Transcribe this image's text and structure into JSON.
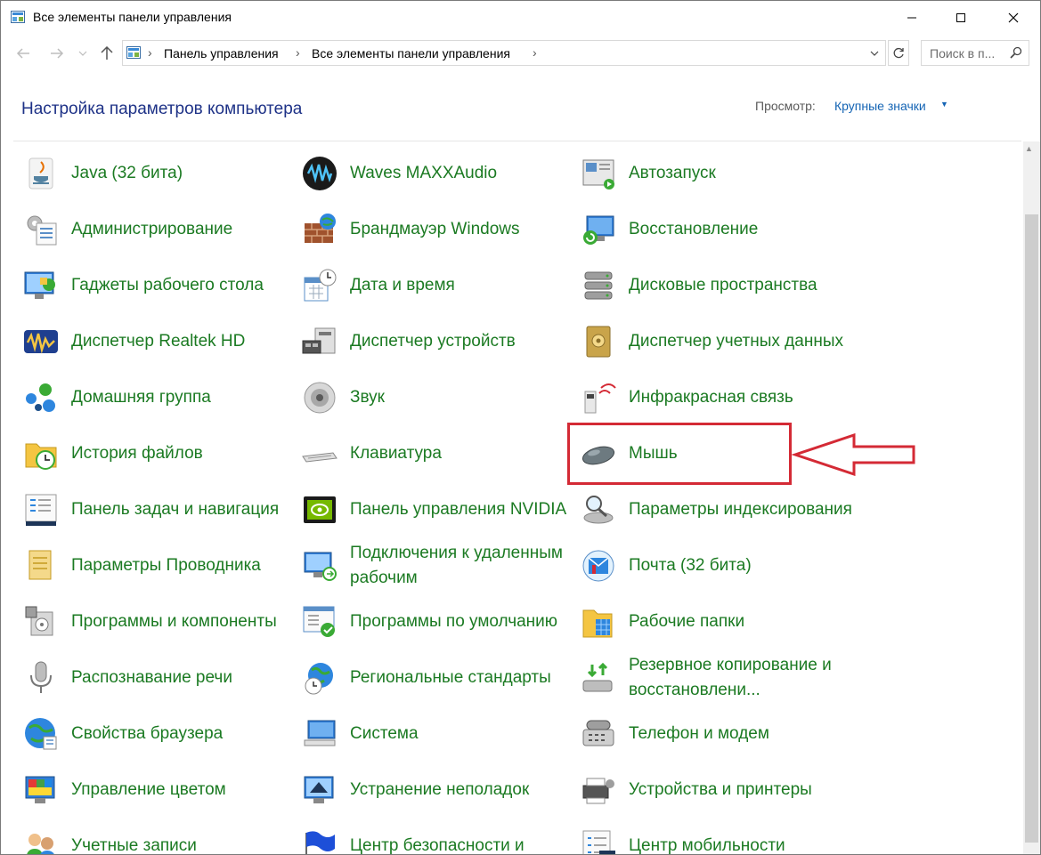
{
  "window": {
    "title": "Все элементы панели управления",
    "minimize_icon": "minimize-icon",
    "maximize_icon": "maximize-icon",
    "close_icon": "close-icon"
  },
  "address_bar": {
    "crumbs": [
      "Панель управления",
      "Все элементы панели управления"
    ],
    "search_placeholder": "Поиск в п..."
  },
  "header": {
    "title": "Настройка параметров компьютера",
    "view_label": "Просмотр:",
    "view_value": "Крупные значки"
  },
  "items": [
    {
      "label": "Java (32 бита)",
      "icon": "java-icon"
    },
    {
      "label": "Waves MAXXAudio",
      "icon": "waves-icon"
    },
    {
      "label": "Автозапуск",
      "icon": "autoplay-icon"
    },
    {
      "label": "Администрирование",
      "icon": "admin-tools-icon"
    },
    {
      "label": "Брандмауэр Windows",
      "icon": "firewall-icon"
    },
    {
      "label": "Восстановление",
      "icon": "recovery-icon"
    },
    {
      "label": "Гаджеты рабочего стола",
      "icon": "gadgets-icon"
    },
    {
      "label": "Дата и время",
      "icon": "datetime-icon"
    },
    {
      "label": "Дисковые пространства",
      "icon": "storage-spaces-icon"
    },
    {
      "label": "Диспетчер Realtek HD",
      "icon": "realtek-icon"
    },
    {
      "label": "Диспетчер устройств",
      "icon": "device-manager-icon"
    },
    {
      "label": "Диспетчер учетных данных",
      "icon": "credential-manager-icon"
    },
    {
      "label": "Домашняя группа",
      "icon": "homegroup-icon"
    },
    {
      "label": "Звук",
      "icon": "sound-icon"
    },
    {
      "label": "Инфракрасная связь",
      "icon": "infrared-icon"
    },
    {
      "label": "История файлов",
      "icon": "file-history-icon"
    },
    {
      "label": "Клавиатура",
      "icon": "keyboard-icon"
    },
    {
      "label": "Мышь",
      "icon": "mouse-icon"
    },
    {
      "label": "Панель задач и навигация",
      "icon": "taskbar-icon"
    },
    {
      "label": "Панель управления NVIDIA",
      "icon": "nvidia-icon"
    },
    {
      "label": "Параметры индексирования",
      "icon": "indexing-icon"
    },
    {
      "label": "Параметры Проводника",
      "icon": "explorer-options-icon"
    },
    {
      "label": "Подключения к удаленным рабочим",
      "icon": "remote-desktop-icon"
    },
    {
      "label": "Почта (32 бита)",
      "icon": "mail-icon"
    },
    {
      "label": "Программы и компоненты",
      "icon": "programs-icon"
    },
    {
      "label": "Программы по умолчанию",
      "icon": "default-programs-icon"
    },
    {
      "label": "Рабочие папки",
      "icon": "work-folders-icon"
    },
    {
      "label": "Распознавание речи",
      "icon": "microphone-icon"
    },
    {
      "label": "Региональные стандарты",
      "icon": "region-icon"
    },
    {
      "label": "Резервное копирование и восстановлени...",
      "icon": "backup-icon"
    },
    {
      "label": "Свойства браузера",
      "icon": "internet-options-icon"
    },
    {
      "label": "Система",
      "icon": "system-icon"
    },
    {
      "label": "Телефон и модем",
      "icon": "phone-modem-icon"
    },
    {
      "label": "Управление цветом",
      "icon": "color-management-icon"
    },
    {
      "label": "Устранение неполадок",
      "icon": "troubleshooting-icon"
    },
    {
      "label": "Устройства и принтеры",
      "icon": "devices-printers-icon"
    },
    {
      "label": "Учетные записи",
      "icon": "user-accounts-icon"
    },
    {
      "label": "Центр безопасности и",
      "icon": "security-center-icon"
    },
    {
      "label": "Центр мобильности",
      "icon": "mobility-center-icon"
    }
  ],
  "colors": {
    "link_green": "#1b7a22",
    "heading_blue": "#1e3287",
    "highlight_red": "#d42a35"
  }
}
